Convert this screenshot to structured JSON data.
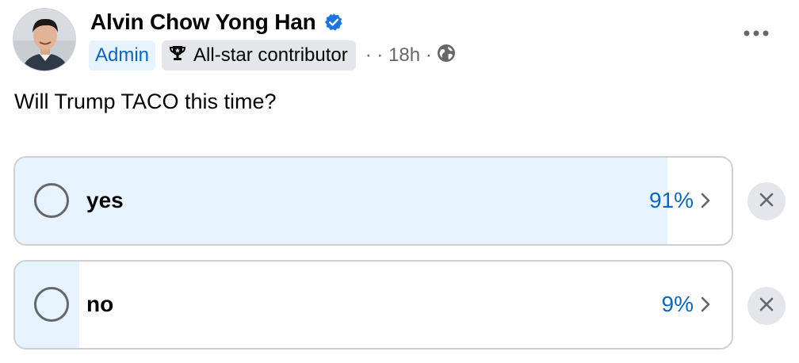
{
  "post": {
    "author": "Alvin Chow Yong Han",
    "badges": {
      "admin": "Admin",
      "contributor": "All-star contributor"
    },
    "time_text": "· · 18h ·",
    "text": "Will Trump TACO this time?"
  },
  "icons": {
    "verified": "verified-badge-icon",
    "trophy": "trophy-icon",
    "privacy": "globe-icon",
    "more": "more-options-icon",
    "chevron": "chevron-right-icon",
    "remove": "close-icon"
  },
  "poll": {
    "options": [
      {
        "label": "yes",
        "percent_label": "91%",
        "fill_fraction": 0.91
      },
      {
        "label": "no",
        "percent_label": "9%",
        "fill_fraction": 0.09
      }
    ]
  },
  "colors": {
    "accent": "#0a66c2",
    "verified": "#1b74e4",
    "poll_fill": "#e7f3ff",
    "border": "#ced0d4",
    "secondary_text": "#65676b"
  }
}
